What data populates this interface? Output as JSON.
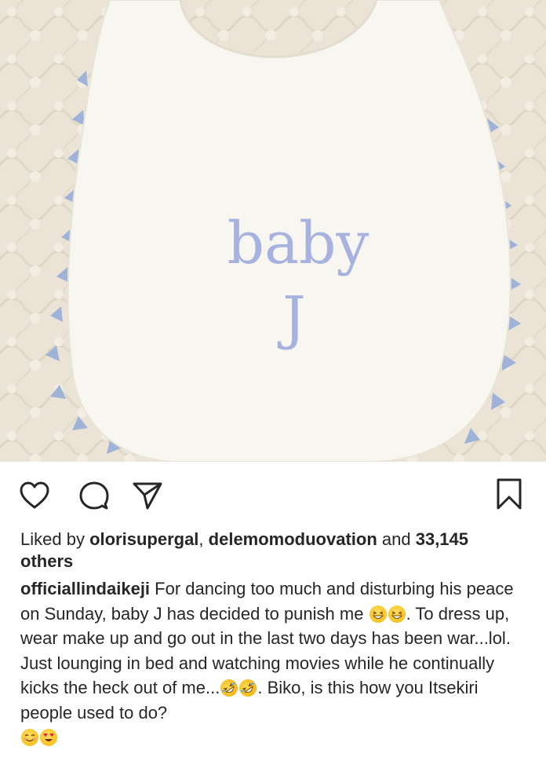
{
  "post": {
    "image": {
      "description_text_line1": "baby",
      "description_text_line2": "J",
      "colors": {
        "quilt": "#ebe4d6",
        "bib": "#f8f6f1",
        "trim": "#9fb3d8",
        "embroidery": "#a8b2de"
      }
    },
    "actions": {
      "like": "heart-icon",
      "comment": "comment-icon",
      "share": "send-icon",
      "save": "bookmark-icon"
    },
    "likes": {
      "prefix": "Liked by ",
      "user1": "olorisupergal",
      "separator": ", ",
      "user2": "delemomoduovation",
      "and": " and ",
      "count": "33,145",
      "suffix": "others"
    },
    "caption": {
      "username": "officiallindaikeji",
      "part1": " For dancing too much and disturbing his peace on Sunday, baby J has decided to punish me ",
      "part2": ". To dress up, wear make up and go out in the last two days has been war...lol. Just lounging in bed and watching movies while he continually kicks the heck out of me...",
      "part3": ". Biko, is this how you Itsekiri people used to do?",
      "emojis": [
        "grinning-squinting-face",
        "grinning-squinting-face",
        "rolling-on-floor-laughing",
        "rolling-on-floor-laughing",
        "smiling-face",
        "heart-eyes-face"
      ]
    }
  }
}
